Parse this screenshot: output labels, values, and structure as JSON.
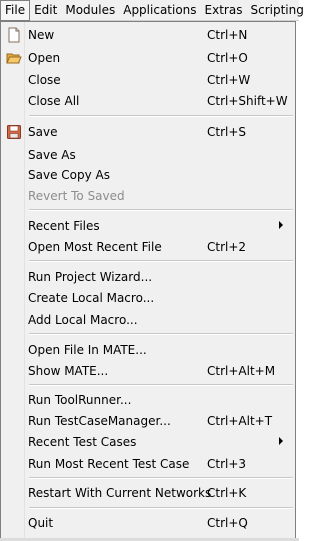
{
  "menubar": {
    "items": [
      "File",
      "Edit",
      "Modules",
      "Applications",
      "Extras",
      "Scripting"
    ]
  },
  "file_menu": {
    "new": {
      "label": "New",
      "shortcut": "Ctrl+N"
    },
    "open": {
      "label": "Open",
      "shortcut": "Ctrl+O"
    },
    "close": {
      "label": "Close",
      "shortcut": "Ctrl+W"
    },
    "close_all": {
      "label": "Close All",
      "shortcut": "Ctrl+Shift+W"
    },
    "save": {
      "label": "Save",
      "shortcut": "Ctrl+S"
    },
    "save_as": {
      "label": "Save As"
    },
    "save_copy_as": {
      "label": "Save Copy As"
    },
    "revert_to_saved": {
      "label": "Revert To Saved"
    },
    "recent_files": {
      "label": "Recent Files"
    },
    "open_most_recent_file": {
      "label": "Open Most Recent File",
      "shortcut": "Ctrl+2"
    },
    "run_project_wizard": {
      "label": "Run Project Wizard..."
    },
    "create_local_macro": {
      "label": "Create Local Macro..."
    },
    "add_local_macro": {
      "label": "Add Local Macro..."
    },
    "open_file_in_mate": {
      "label": "Open File In MATE..."
    },
    "show_mate": {
      "label": "Show MATE...",
      "shortcut": "Ctrl+Alt+M"
    },
    "run_toolrunner": {
      "label": "Run ToolRunner..."
    },
    "run_testcasemanager": {
      "label": "Run TestCaseManager...",
      "shortcut": "Ctrl+Alt+T"
    },
    "recent_test_cases": {
      "label": "Recent Test Cases"
    },
    "run_most_recent_test_case": {
      "label": "Run Most Recent Test Case",
      "shortcut": "Ctrl+3"
    },
    "restart_with_current_networks": {
      "label": "Restart With Current Networks",
      "shortcut": "Ctrl+K"
    },
    "quit": {
      "label": "Quit",
      "shortcut": "Ctrl+Q"
    }
  },
  "icons": {
    "new": "new-document-icon",
    "open": "open-folder-icon",
    "save": "save-disk-icon"
  },
  "colors": {
    "menu_background": "#f0f0f0",
    "disabled_text": "#8d8d8d",
    "border": "#7f7f7f"
  }
}
